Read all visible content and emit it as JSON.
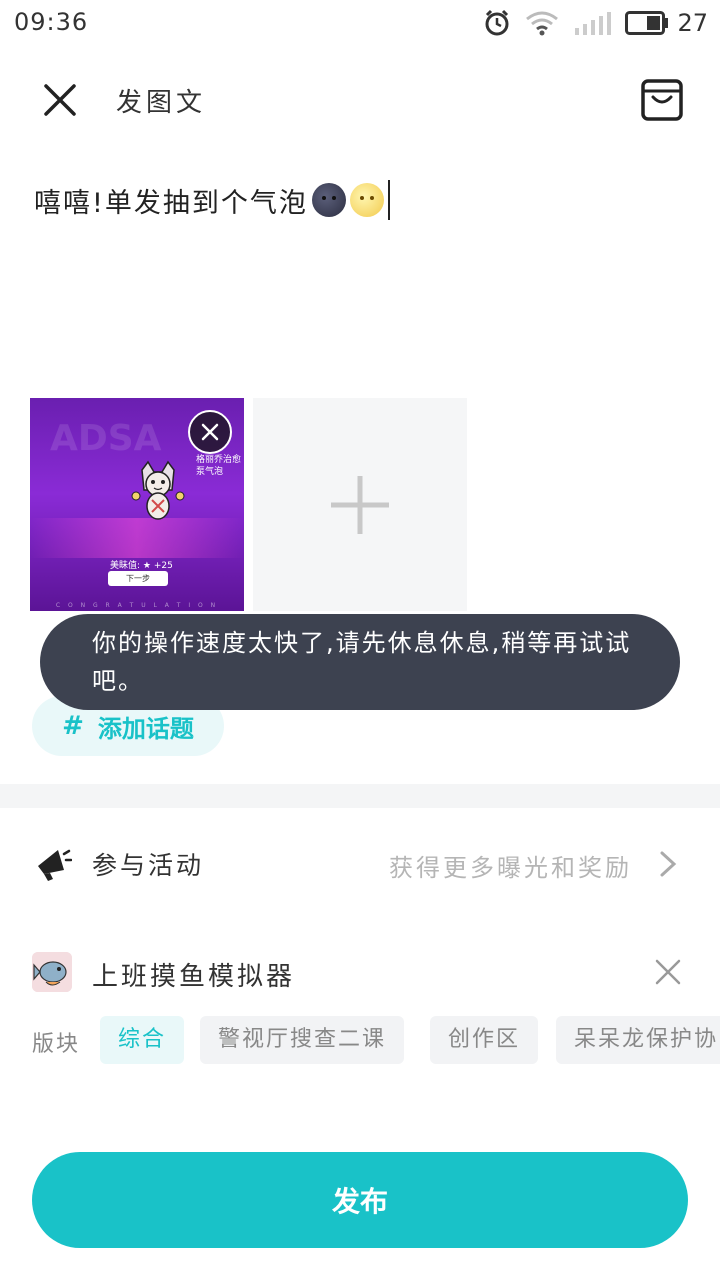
{
  "status_bar": {
    "time": "09:36",
    "battery": "27",
    "icons": [
      "alarm-icon",
      "wifi-icon",
      "signal-icon",
      "battery-icon"
    ]
  },
  "header": {
    "title": "发图文",
    "close_icon": "close-icon",
    "draft_icon": "draft-box-icon"
  },
  "post": {
    "text": "嘻嘻!单发抽到个气泡",
    "emojis": [
      "new-moon-face",
      "full-moon-face"
    ]
  },
  "image": {
    "banner": "ADSA",
    "item_name": "格丽乔治愈泵气泡",
    "charm": "美眛值: ★ +25",
    "next_button": "下一步",
    "footer": "C O N G R A T U L A T I O N"
  },
  "topic": {
    "hash": "#",
    "label": "添加话题"
  },
  "toast": {
    "message": "你的操作速度太快了,请先休息休息,稍等再试试吧。"
  },
  "activity": {
    "label": "参与活动",
    "hint": "获得更多曝光和奖励"
  },
  "community": {
    "name": "上班摸鱼模拟器"
  },
  "sections": {
    "label": "版块",
    "chips": [
      "综合",
      "警视厅搜查二课",
      "创作区",
      "呆呆龙保护协"
    ],
    "selected": "综合"
  },
  "publish": {
    "label": "发布"
  },
  "colors": {
    "accent": "#19c2c8",
    "toast_bg": "#3d4250"
  }
}
